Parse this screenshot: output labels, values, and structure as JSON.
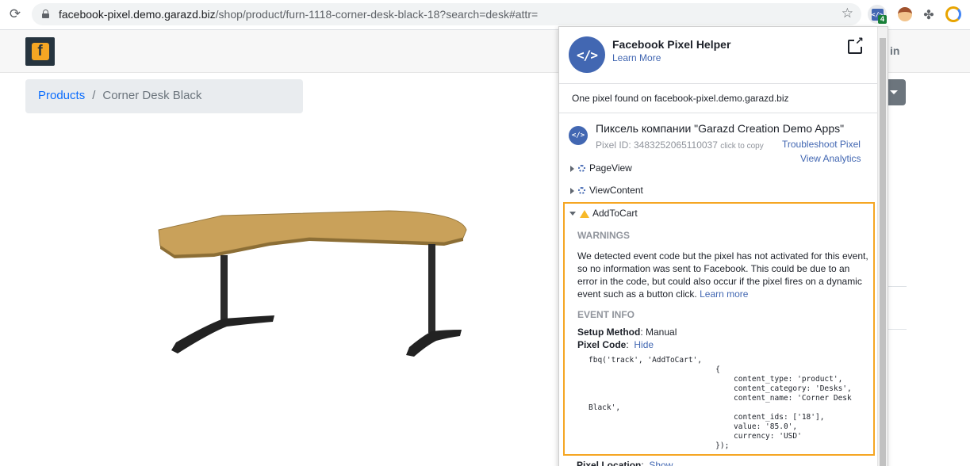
{
  "browser": {
    "url_host": "facebook-pixel.demo.garazd.biz",
    "url_rest": "/shop/product/furn-1118-corner-desk-black-18?search=desk#attr=",
    "ext_badge": "4"
  },
  "page": {
    "logo_letter": "f",
    "signin_partial": "in",
    "breadcrumb": {
      "link": "Products",
      "separator": "/",
      "current": "Corner Desk Black"
    }
  },
  "popup": {
    "title": "Facebook Pixel Helper",
    "learn_more": "Learn More",
    "found_text": "One pixel found on facebook-pixel.demo.garazd.biz",
    "pixel": {
      "name": "Пиксель компании \"Garazd Creation Demo Apps\"",
      "id_label": "Pixel ID: 3483252065110037",
      "click_to_copy": "click to copy",
      "troubleshoot": "Troubleshoot Pixel",
      "analytics": "View Analytics"
    },
    "events": [
      {
        "name": "PageView"
      },
      {
        "name": "ViewContent"
      }
    ],
    "addtocart": {
      "name": "AddToCart",
      "warnings_title": "WARNINGS",
      "warning_text": "We detected event code but the pixel has not activated for this event, so no information was sent to Facebook. This could be due to an error in the code, but could also occur if the pixel fires on a dynamic event such as a button click.",
      "warning_learn_more": "Learn more",
      "event_info_title": "EVENT INFO",
      "setup_label": "Setup Method",
      "setup_value": ": Manual",
      "pixel_code_label": "Pixel Code",
      "pixel_code_colon": ":",
      "hide": "Hide",
      "code": "fbq('track', 'AddToCart',\n                            {\n                                content_type: 'product',\n                                content_category: 'Desks',\n                                content_name: 'Corner Desk\nBlack',\n                                content_ids: ['18'],\n                                value: '85.0',\n                                currency: 'USD'\n                            });"
    },
    "pixel_location_label": "Pixel Location",
    "pixel_location_colon": ":",
    "show": "Show"
  }
}
